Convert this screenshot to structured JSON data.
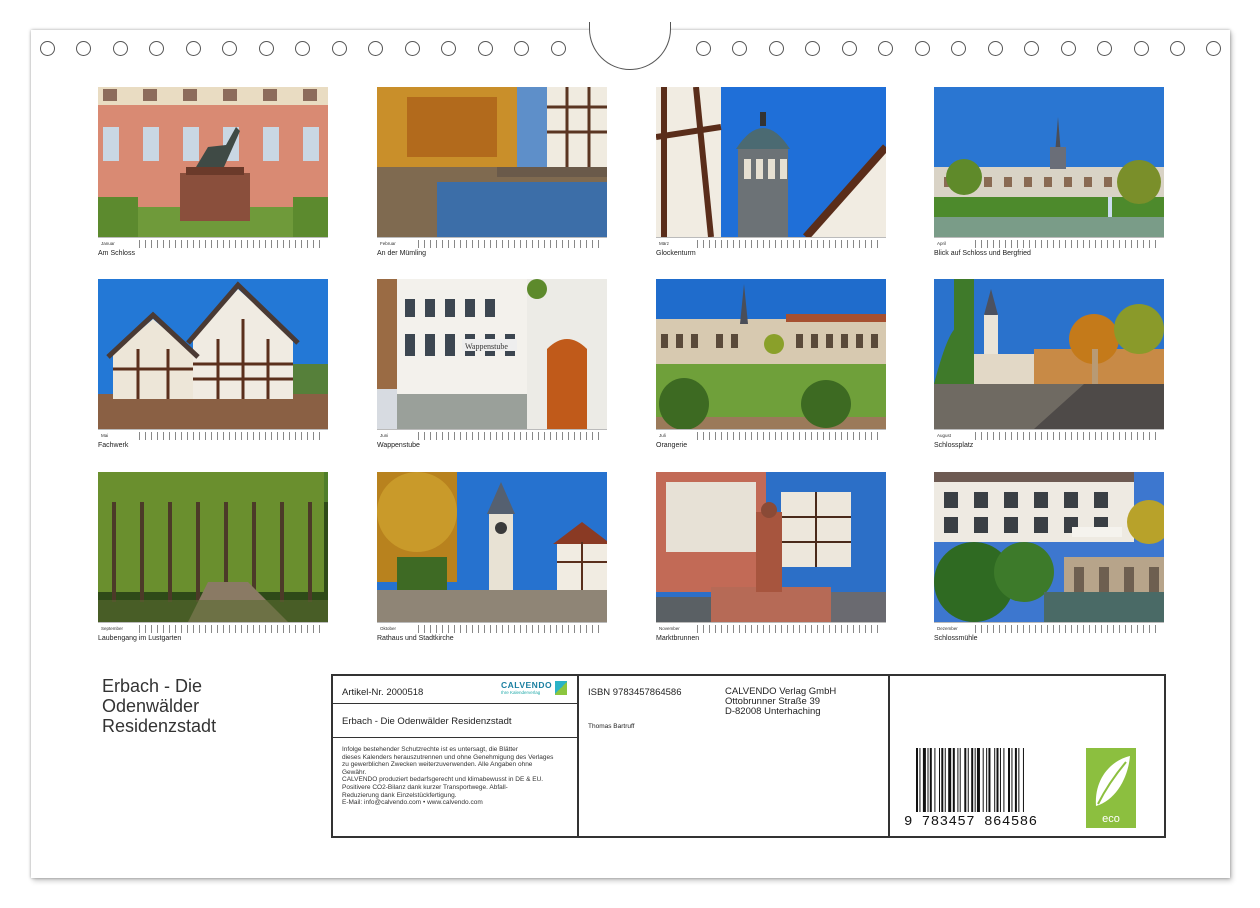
{
  "calendar": {
    "title_lines": [
      "Erbach - Die",
      "Odenwälder",
      "Residenzstadt"
    ],
    "months": [
      {
        "month": "Januar",
        "caption": "Am Schloss"
      },
      {
        "month": "Februar",
        "caption": "An der Mümling"
      },
      {
        "month": "März",
        "caption": "Glockenturm"
      },
      {
        "month": "April",
        "caption": "Blick auf Schloss und Bergfried"
      },
      {
        "month": "Mai",
        "caption": "Fachwerk"
      },
      {
        "month": "Juni",
        "caption": "Wappenstube"
      },
      {
        "month": "Juli",
        "caption": "Orangerie"
      },
      {
        "month": "August",
        "caption": "Schlossplatz"
      },
      {
        "month": "September",
        "caption": "Laubengang im Lustgarten"
      },
      {
        "month": "Oktober",
        "caption": "Rathaus und Stadtkirche"
      },
      {
        "month": "November",
        "caption": "Marktbrunnen"
      },
      {
        "month": "Dezember",
        "caption": "Schlossmühle"
      }
    ]
  },
  "info": {
    "article": "Artikel-Nr. 2000518",
    "logo_text": "CALVENDO",
    "logo_sub": "Ihre Kalenderverlag",
    "product_title": "Erbach - Die Odenwälder Residenzstadt",
    "legal_lines": [
      "Infolge bestehender Schutzrechte ist es untersagt, die Blätter",
      "dieses Kalenders herauszutrennen und ohne Genehmigung des Verlages",
      "zu gewerblichen Zwecken weiterzuverwenden. Alle Angaben ohne",
      "Gewähr.",
      "CALVENDO produziert bedarfsgerecht und klimabewusst in DE & EU.",
      "Positivere CO2-Bilanz dank kurzer Transportwege. Abfall-",
      "Reduzierung dank Einzelstückfertigung.",
      "E-Mail: info@calvendo.com • www.calvendo.com"
    ],
    "isbn": "ISBN 9783457864586",
    "author": "Thomas Bartruff",
    "publisher_lines": [
      "CALVENDO Verlag GmbH",
      "Ottobrunner Straße 39",
      "D-82008 Unterhaching"
    ],
    "barcode_number": "9 783457 864586",
    "eco_label": "eco"
  }
}
